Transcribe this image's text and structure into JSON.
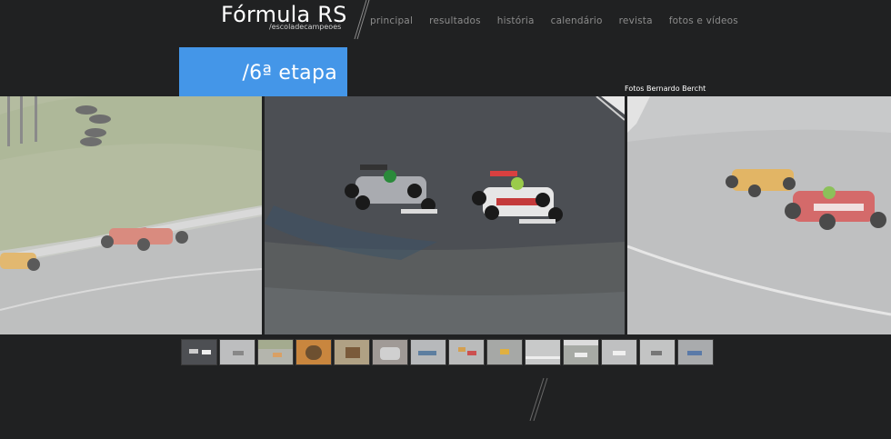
{
  "header": {
    "logo_title": "Fórmula RS",
    "logo_subtitle": "/escoladecampeoes"
  },
  "nav": {
    "items": [
      {
        "label": "principal"
      },
      {
        "label": "resultados"
      },
      {
        "label": "história"
      },
      {
        "label": "calendário"
      },
      {
        "label": "revista"
      },
      {
        "label": "fotos e vídeos"
      }
    ]
  },
  "page": {
    "title": "/6ª etapa",
    "photo_credit": "Fotos Bernardo Bercht"
  },
  "colors": {
    "background": "#202122",
    "accent": "#4496e8",
    "nav_text": "#8c8c8c"
  },
  "gallery": {
    "thumbnail_count": 14,
    "selected_index": 0
  }
}
